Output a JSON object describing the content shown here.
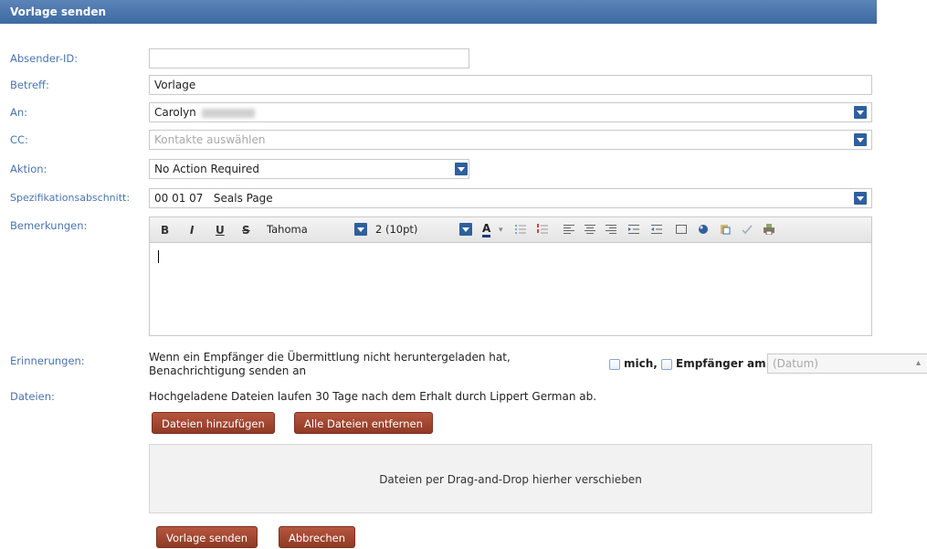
{
  "title": "Vorlage senden",
  "labels": {
    "sender_id": "Absender-ID:",
    "subject": "Betreff:",
    "to": "An:",
    "cc": "CC:",
    "action": "Aktion:",
    "spec_section": "Spezifikationsabschnitt:",
    "remarks": "Bemerkungen:",
    "reminders": "Erinnerungen:",
    "files": "Dateien:"
  },
  "fields": {
    "sender_id_value": "",
    "subject_value": "Vorlage",
    "to_value": "Carolyn",
    "cc_placeholder": "Kontakte auswählen",
    "action_value": "No Action Required",
    "spec_section_value": "00 01 07   Seals Page"
  },
  "toolbar": {
    "bold": "B",
    "italic": "I",
    "underline": "U",
    "strike": "S",
    "font_family": "Tahoma",
    "font_size": "2 (10pt)",
    "font_color": "A",
    "icons": [
      "bold-icon",
      "italic-icon",
      "underline-icon",
      "strikethrough-icon",
      "font-color-icon",
      "bulleted-list-icon",
      "numbered-list-icon",
      "align-left-icon",
      "align-center-icon",
      "align-right-icon",
      "indent-icon",
      "outdent-icon",
      "table-icon",
      "link-icon",
      "paste-icon",
      "spellcheck-icon",
      "print-icon"
    ]
  },
  "reminders": {
    "text_line1": "Wenn ein Empfänger die Übermittlung nicht heruntergeladen hat,",
    "text_line2": "Benachrichtigung senden an",
    "me_label": "mich,",
    "recipient_label": "Empfänger am",
    "date_placeholder": "(Datum)"
  },
  "files": {
    "info": "Hochgeladene Dateien laufen 30 Tage nach dem Erhalt durch Lippert German ab.",
    "add_button": "Dateien hinzufügen",
    "remove_button": "Alle Dateien entfernen",
    "dropzone_text": "Dateien per Drag-and-Drop hierher verschieben"
  },
  "footer": {
    "send_button": "Vorlage senden",
    "cancel_button": "Abbrechen"
  },
  "colors": {
    "title_bar": "#3d6aa3",
    "label": "#4a74b0",
    "button": "#a14a34",
    "dropdown": "#2f5f9e"
  }
}
